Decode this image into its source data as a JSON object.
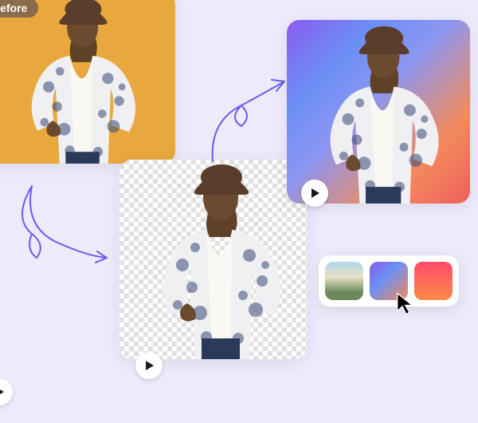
{
  "stage1": {
    "badge": "Before",
    "alt": "Original photo on yellow background"
  },
  "stage2": {
    "alt": "Background removed — transparent checkerboard"
  },
  "stage3": {
    "alt": "New gradient background applied"
  },
  "controls": {
    "play": "Play"
  },
  "presets": {
    "options": [
      {
        "name": "beach-scene",
        "swatch": "#b0d8e8"
      },
      {
        "name": "purple-gradient",
        "swatch": "#8a5cf0"
      },
      {
        "name": "red-gradient",
        "swatch": "#ff4a6a"
      }
    ],
    "selected_index": 1
  },
  "colors": {
    "accent": "#6b5ce8"
  }
}
